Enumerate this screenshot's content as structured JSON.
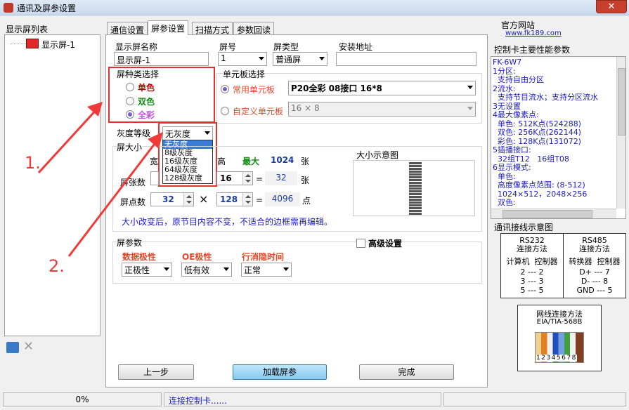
{
  "window": {
    "title": "通讯及屏参设置",
    "close": "✕"
  },
  "left": {
    "header": "显示屏列表",
    "tree_item": "显示屏-1"
  },
  "tabs": [
    "通信设置",
    "屏参设置",
    "扫描方式",
    "参数回读"
  ],
  "screen": {
    "name_label": "显示屏名称",
    "name_value": "显示屏-1",
    "num_label": "屏号",
    "num_value": "1",
    "type_label": "屏类型",
    "type_value": "普通屏",
    "addr_label": "安装地址",
    "addr_value": ""
  },
  "color_select": {
    "title": "屏种类选择",
    "options": [
      "单色",
      "双色",
      "全彩"
    ],
    "selected": "全彩",
    "option_colors": [
      "#c00000",
      "#118a11",
      "#c050e0"
    ]
  },
  "unit": {
    "title": "单元板选择",
    "common_label": "常用单元板",
    "common_value": "P20全彩  08接口  16*8",
    "custom_label": "自定义单元板",
    "custom_value": "16 × 8"
  },
  "gray": {
    "label": "灰度等级",
    "value": "无灰度",
    "options": [
      "无灰度",
      "8级灰度",
      "16级灰度",
      "64级灰度",
      "128级灰度"
    ]
  },
  "size": {
    "title": "屏大小",
    "width_label": "宽",
    "height_label": "高",
    "max_label": "最大",
    "max_value": "1024",
    "unit_zhang": "张",
    "boards_label": "屏张数",
    "boards_h": "16",
    "eq": "=",
    "boards_total": "32",
    "points_label": "屏点数",
    "points_w": "32",
    "times": "×",
    "points_h": "128",
    "points_total": "4096",
    "unit_dian": "点",
    "preview_label": "大小示意图",
    "note": "大小改变后，原节目内容不变，不适合的边框需再编辑。"
  },
  "params": {
    "title": "屏参数",
    "advanced": "高级设置",
    "data_polarity_label": "数据极性",
    "data_polarity_value": "正极性",
    "oe_label": "OE极性",
    "oe_value": "低有效",
    "blank_label": "行消隐时间",
    "blank_value": "正常"
  },
  "buttons": {
    "prev": "上一步",
    "load": "加载屏参",
    "finish": "完成"
  },
  "right": {
    "site_label": "官方网站",
    "site_url": "www.fk189.com",
    "perf_title": "控制卡主要性能参数",
    "perf_lines": [
      "FK-6W7",
      "1分区:",
      "  支持自由分区",
      "2流水:",
      "  支持节目流水；支持分区流水",
      "3无设置",
      "4最大像素点:",
      "  单色: 512K点(524288)",
      "  双色: 256K点(262144)",
      "  彩色: 128K点(131072)",
      "5插播接口:",
      "  32组T12   16组T08",
      "6显示模式:",
      "  单色:",
      "  高度像素点范围: (8-512)",
      "  1024×512，2048×256",
      "  双色:"
    ],
    "wiring_title": "通讯接线示意图",
    "rs232": {
      "title": "RS232",
      "sub": "连接方法",
      "cols": "计算机  控制器",
      "rows": [
        "2 --- 2",
        "3 --- 3",
        "5 --- 5"
      ]
    },
    "rs485": {
      "title": "RS485",
      "sub": "连接方法",
      "cols": "转换器  控制器",
      "rows": [
        "D+ --- 7",
        "D- --- 8",
        "GND --- 5"
      ]
    },
    "net": {
      "title": "网线连接方法",
      "sub": "EIA/TIA-568B",
      "pins": "12345678"
    }
  },
  "annotations": {
    "one": "1.",
    "two": "2."
  },
  "status": {
    "progress": "0%",
    "progress_value": 0,
    "message": "连接控制卡......"
  }
}
